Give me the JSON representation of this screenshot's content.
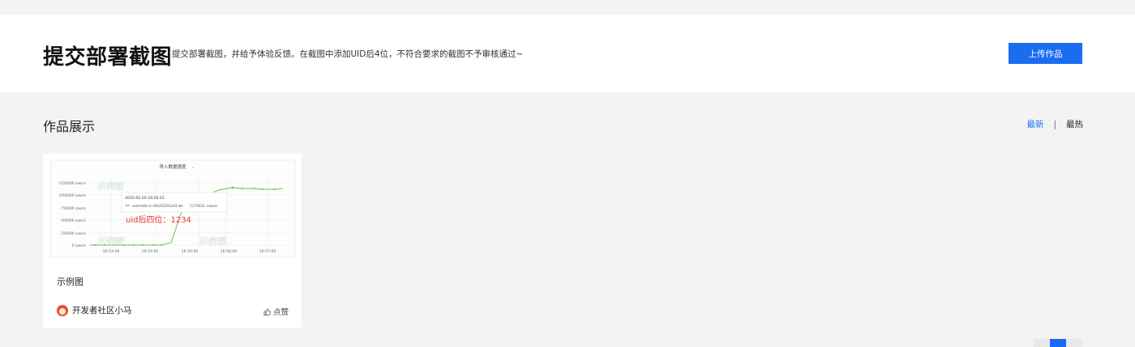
{
  "header": {
    "title": "提交部署截图",
    "subtitle": "提交部署截图，并给予体验反馈。在截图中添加UID后4位，不符合要求的截图不予审核通过~",
    "upload_label": "上传作品"
  },
  "gallery": {
    "section_title": "作品展示",
    "sort": {
      "newest": "最新",
      "separator": "|",
      "hottest": "最热",
      "active": "newest"
    }
  },
  "cards": [
    {
      "title": "示例图",
      "author": "开发者社区小马",
      "like_label": "点赞",
      "thumbnail": {
        "chart_title": "导入数据速度",
        "y_ticks": [
          "1250000 rows/s",
          "1000000 rows/s",
          "750000 rows/s",
          "500000 rows/s",
          "250000 rows/s",
          "0 rows/s"
        ],
        "x_ticks": [
          "16:53:00",
          "16:54:00",
          "16:55:00",
          "16:56:00",
          "16:57:00"
        ],
        "tooltip_time": "2025-02-20 16:56:15",
        "tooltip_series": "selectdb-cn-06z45291o02-be",
        "tooltip_value": "1170021 rows/s",
        "annotation": "uid后四位：1234",
        "watermark": "示例图"
      }
    }
  ],
  "colors": {
    "accent": "#1a6df0",
    "annotation": "#e53935",
    "series": "#6cc04a"
  }
}
